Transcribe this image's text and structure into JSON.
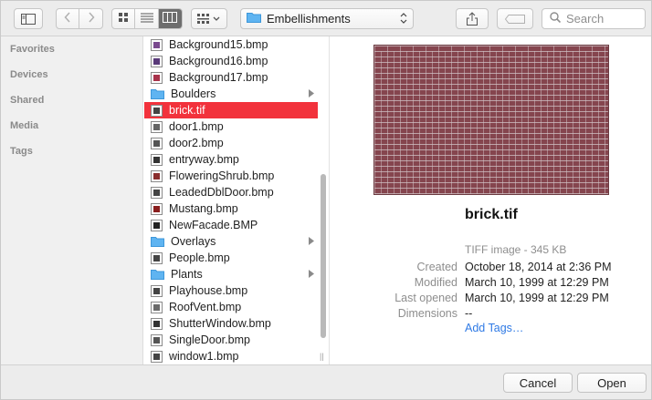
{
  "toolbar": {
    "location": "Embellishments",
    "search_placeholder": "Search",
    "icons": [
      "sidebar-toggle-icon",
      "back-icon",
      "forward-icon",
      "icon-view-icon",
      "list-view-icon",
      "column-view-icon",
      "arrange-icon",
      "folder-icon",
      "share-icon",
      "tag-icon",
      "search-icon"
    ]
  },
  "sidebar": {
    "sections": [
      {
        "label": "Favorites"
      },
      {
        "label": "Devices"
      },
      {
        "label": "Shared"
      },
      {
        "label": "Media"
      },
      {
        "label": "Tags"
      }
    ]
  },
  "files": [
    {
      "name": "Background15.bmp",
      "type": "image",
      "selected": false
    },
    {
      "name": "Background16.bmp",
      "type": "image",
      "selected": false
    },
    {
      "name": "Background17.bmp",
      "type": "image",
      "selected": false
    },
    {
      "name": "Boulders",
      "type": "folder",
      "selected": false
    },
    {
      "name": "brick.tif",
      "type": "image",
      "selected": true
    },
    {
      "name": "door1.bmp",
      "type": "image",
      "selected": false
    },
    {
      "name": "door2.bmp",
      "type": "image",
      "selected": false
    },
    {
      "name": "entryway.bmp",
      "type": "image",
      "selected": false
    },
    {
      "name": "FloweringShrub.bmp",
      "type": "image",
      "selected": false
    },
    {
      "name": "LeadedDblDoor.bmp",
      "type": "image",
      "selected": false
    },
    {
      "name": "Mustang.bmp",
      "type": "image",
      "selected": false
    },
    {
      "name": "NewFacade.BMP",
      "type": "image",
      "selected": false
    },
    {
      "name": "Overlays",
      "type": "folder",
      "selected": false
    },
    {
      "name": "People.bmp",
      "type": "image",
      "selected": false
    },
    {
      "name": "Plants",
      "type": "folder",
      "selected": false
    },
    {
      "name": "Playhouse.bmp",
      "type": "image",
      "selected": false
    },
    {
      "name": "RoofVent.bmp",
      "type": "image",
      "selected": false
    },
    {
      "name": "ShutterWindow.bmp",
      "type": "image",
      "selected": false
    },
    {
      "name": "SingleDoor.bmp",
      "type": "image",
      "selected": false
    },
    {
      "name": "window1.bmp",
      "type": "image",
      "selected": false
    }
  ],
  "preview": {
    "filename": "brick.tif",
    "kind": "TIFF image - 345 KB",
    "meta": [
      {
        "label": "Created",
        "value": "October 18, 2014 at 2:36 PM"
      },
      {
        "label": "Modified",
        "value": "March 10, 1999 at 12:29 PM"
      },
      {
        "label": "Last opened",
        "value": "March 10, 1999 at 12:29 PM"
      },
      {
        "label": "Dimensions",
        "value": "--"
      }
    ],
    "add_tags": "Add Tags…"
  },
  "buttons": {
    "cancel": "Cancel",
    "open": "Open"
  },
  "colors": {
    "selection": "#f2323c",
    "link": "#2f7ae5",
    "folder": "#5fb4f1"
  }
}
